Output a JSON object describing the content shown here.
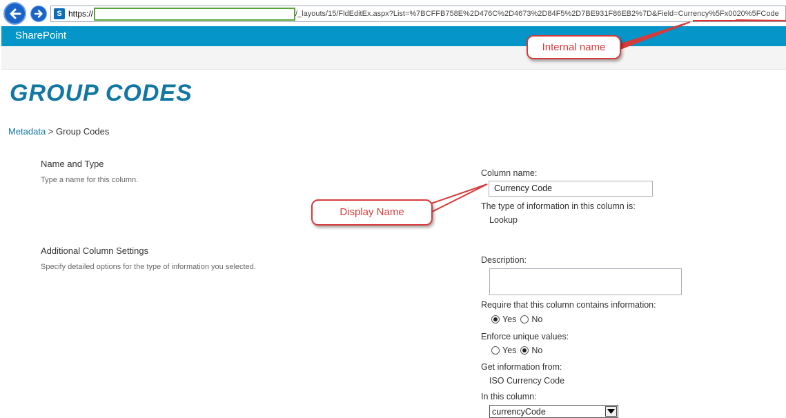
{
  "browser": {
    "url_prefix": "https://",
    "url_rest": "/_layouts/15/FldEditEx.aspx?List=%7BCFFB758E%2D476C%2D4673%2D84F5%2D7BE931F86EB2%7D&Field=Currency%5Fx0020%5FCode",
    "back_icon": "arrow-left-icon",
    "forward_icon": "arrow-right-icon",
    "site_icon": "sharepoint-icon"
  },
  "suitebar": {
    "title": "SharePoint",
    "color": "#0595c9"
  },
  "page": {
    "title": "GROUP CODES",
    "breadcrumb": {
      "link": "Metadata",
      "separator": " > ",
      "current": "Group Codes"
    }
  },
  "sections": {
    "name_type": {
      "title": "Name and Type",
      "description": "Type a name for this column."
    },
    "additional": {
      "title": "Additional Column Settings",
      "description": "Specify detailed options for the type of information you selected."
    }
  },
  "form": {
    "column_name_label": "Column name:",
    "column_name_value": "Currency Code",
    "type_label": "The type of information in this column is:",
    "type_value": "Lookup",
    "description_label": "Description:",
    "description_value": "",
    "require_label": "Require that this column contains information:",
    "require_yes": "Yes",
    "require_no": "No",
    "require_selected": "Yes",
    "unique_label": "Enforce unique values:",
    "unique_yes": "Yes",
    "unique_no": "No",
    "unique_selected": "No",
    "get_info_label": "Get information from:",
    "get_info_value": "ISO Currency Code",
    "in_column_label": "In this column:",
    "in_column_value": "currencyCode"
  },
  "annotations": {
    "internal_name": "Internal name",
    "display_name": "Display Name",
    "color": "#d73a3a"
  }
}
